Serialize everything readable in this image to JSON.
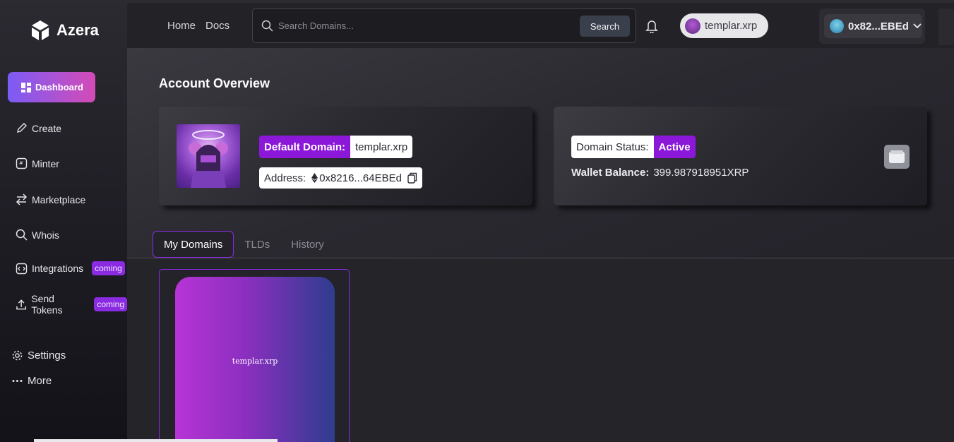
{
  "brand": {
    "name": "Azera"
  },
  "sidebar": {
    "active": {
      "label": "Dashboard",
      "icon": "dashboard-icon"
    },
    "items": [
      {
        "label": "Create",
        "icon": "pencil-icon"
      },
      {
        "label": "Minter",
        "icon": "minter-icon"
      },
      {
        "label": "Marketplace",
        "icon": "swap-arrows-icon"
      },
      {
        "label": "Whois",
        "icon": "search-icon"
      },
      {
        "label": "Integrations",
        "icon": "integrations-icon",
        "badge": "coming"
      },
      {
        "label": "Send Tokens",
        "icon": "upload-icon",
        "badge": "coming"
      }
    ],
    "settings": {
      "label": "Settings",
      "icon": "gear-icon"
    },
    "more": {
      "label": "More",
      "icon": "dots-icon"
    }
  },
  "topbar": {
    "links": [
      "Home",
      "Docs"
    ],
    "search": {
      "placeholder": "Search Domains...",
      "button": "Search"
    },
    "user_domain": "templar.xrp",
    "wallet_short": "0x82...EBEd"
  },
  "overview": {
    "title": "Account Overview",
    "default_domain_label": "Default Domain:",
    "default_domain": "templar.xrp",
    "address_label": "Address:",
    "address": "0x8216...64EBEd",
    "status_label": "Domain Status:",
    "status": "Active",
    "balance_label": "Wallet Balance:",
    "balance": "399.987918951XRP"
  },
  "tabs": [
    "My Domains",
    "TLDs",
    "History"
  ],
  "domains": [
    {
      "name": "templar.xrp"
    }
  ],
  "colors": {
    "accent": "#8b18d8",
    "gradient_start": "#7b5cf5",
    "gradient_end": "#d44bb6"
  }
}
